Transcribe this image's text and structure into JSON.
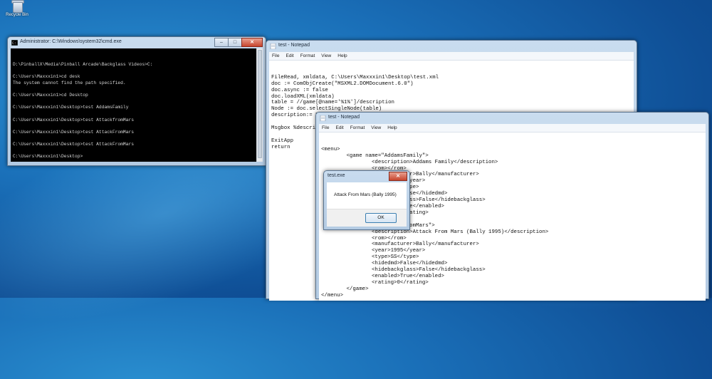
{
  "desktop": {
    "recycle_bin_label": "Recycle Bin"
  },
  "cmd": {
    "title": "Administrator: C:\\Windows\\system32\\cmd.exe",
    "lines": [
      "D:\\PinballX\\Media\\Pinball Arcade\\Backglass Videos>C:",
      "",
      "C:\\Users\\Maxxxin1>cd desk",
      "The system cannot find the path specified.",
      "",
      "C:\\Users\\Maxxxin1>cd Desktop",
      "",
      "C:\\Users\\Maxxxin1\\Desktop>test AddamsFamily",
      "",
      "C:\\Users\\Maxxxin1\\Desktop>test AttackfromMars",
      "",
      "C:\\Users\\Maxxxin1\\Desktop>test AttackFromMars",
      "",
      "C:\\Users\\Maxxxin1\\Desktop>test AttackFromMars",
      "",
      "C:\\Users\\Maxxxin1\\Desktop>"
    ]
  },
  "notepad1": {
    "title": "test - Notepad",
    "menu": [
      "File",
      "Edit",
      "Format",
      "View",
      "Help"
    ],
    "lines": [
      "FileRead, xmldata, C:\\Users\\Maxxxin1\\Desktop\\test.xml",
      "doc := ComObjCreate(\"MSXML2.DOMDocument.6.0\")",
      "doc.async := false",
      "doc.loadXML(xmldata)",
      "table = //game[@name='%1%']/description",
      "Node := doc.selectSingleNode(table)",
      "description:= Node.text",
      "",
      "Msgbox %description%",
      "",
      "ExitApp",
      "return"
    ]
  },
  "notepad2": {
    "title": "test - Notepad",
    "menu": [
      "File",
      "Edit",
      "Format",
      "View",
      "Help"
    ],
    "lines": [
      "<menu>",
      "        <game name=\"AddamsFamily\">",
      "                <description>Addams Family</description>",
      "                <rom></rom>",
      "                <manufacturer>Bally</manufacturer>",
      "                <year>1995</year>",
      "                <type>SS</type>",
      "                <hidedmd>False</hidedmd>",
      "                <hidebackglass>False</hidebackglass>",
      "                <enabled>True</enabled>",
      "                <rating>0</rating>",
      "        </game>",
      "        <game name=\"AttackFromMars\">",
      "                <description>Attack From Mars (Bally 1995)</description>",
      "                <rom></rom>",
      "                <manufacturer>Bally</manufacturer>",
      "                <year>1995</year>",
      "                <type>SS</type>",
      "                <hidedmd>False</hidedmd>",
      "                <hidebackglass>False</hidebackglass>",
      "                <enabled>True</enabled>",
      "                <rating>0</rating>",
      "        </game>",
      "</menu>"
    ]
  },
  "msgbox": {
    "title": "test.exe",
    "text": "Attack From Mars (Bally 1995)",
    "ok_label": "OK"
  },
  "caption_buttons": {
    "minimize": "–",
    "maximize": "□",
    "close": "✕"
  }
}
